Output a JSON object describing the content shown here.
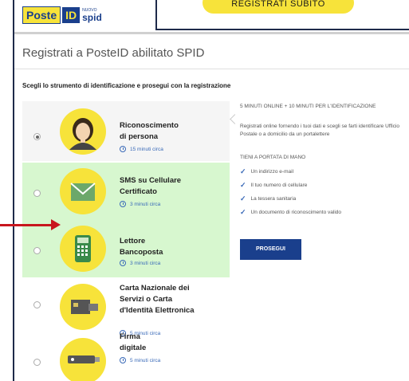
{
  "header": {
    "logo_poste": "Poste",
    "logo_id": "ID",
    "logo_nuovo": "NUOVO",
    "logo_spid": "spid",
    "register_button": "REGISTRATI SUBITO"
  },
  "page_title": "Registrati a PosteID abilitato SPID",
  "instruction": "Scegli lo strumento di identificazione e prosegui con la registrazione",
  "options": [
    {
      "title_line1": "Riconoscimento",
      "title_line2": "di persona",
      "title_line3": "",
      "time": "15 minuti circa",
      "icon": "person-avatar-icon",
      "selected": true
    },
    {
      "title_line1": "SMS su Cellulare",
      "title_line2": "Certificato",
      "title_line3": "",
      "time": "3 minuti circa",
      "icon": "envelope-icon",
      "selected": false
    },
    {
      "title_line1": "Lettore",
      "title_line2": "Bancoposta",
      "title_line3": "",
      "time": "3 minuti circa",
      "icon": "card-reader-icon",
      "selected": false
    },
    {
      "title_line1": "Carta Nazionale dei",
      "title_line2": "Servizi o Carta",
      "title_line3": "d'Identità Elettronica",
      "time": "5 minuti circa",
      "icon": "id-card-icon",
      "selected": false
    },
    {
      "title_line1": "Firma",
      "title_line2": "digitale",
      "title_line3": "",
      "time": "5 minuti circa",
      "icon": "usb-key-icon",
      "selected": false
    }
  ],
  "details": {
    "heading": "5 MINUTI ONLINE + 10 MINUTI PER L'IDENTIFICAZIONE",
    "description": "Registrati online fornendo i tuoi dati e scegli se farti identificare Ufficio Postale o a domicilio da un portalettere",
    "tieni_heading": "TIENI A PORTATA DI MANO",
    "items": [
      "Un indirizzo e-mail",
      "Il tuo numero di cellulare",
      "La tessera sanitaria",
      "Un documento di riconoscimento valido"
    ],
    "continue_button": "PROSEGUI"
  },
  "colors": {
    "accent_yellow": "#f7e33a",
    "brand_blue": "#1a3f8c",
    "highlight_green": "#d7f7cf",
    "arrow_red": "#c8161d"
  }
}
